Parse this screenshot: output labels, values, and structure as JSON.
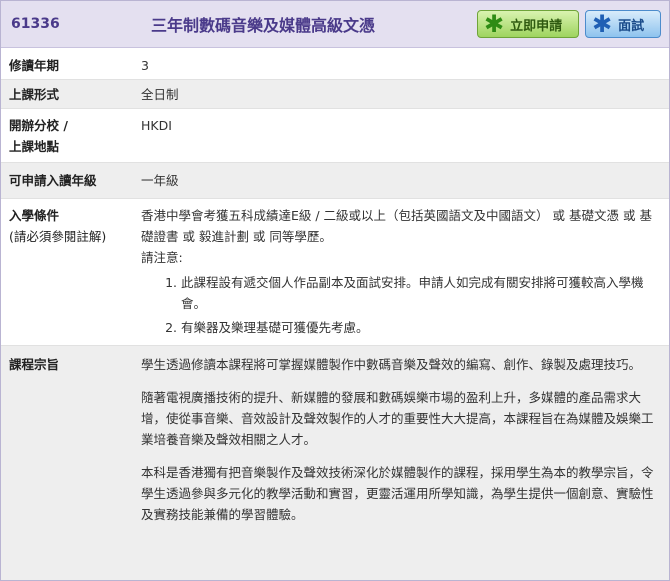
{
  "course": {
    "code": "61336",
    "title": "三年制數碼音樂及媒體高級文憑"
  },
  "buttons": {
    "apply_label": "立即申請",
    "interview_label": "面試"
  },
  "rows": {
    "duration": {
      "label": "修讀年期",
      "value": "3"
    },
    "mode": {
      "label": "上課形式",
      "value": "全日制"
    },
    "campus": {
      "label_line1": "開辦分校 /",
      "label_line2": "上課地點",
      "value": "HKDI"
    },
    "entry_year": {
      "label": "可申請入讀年級",
      "value": "一年級"
    },
    "entry_requirements": {
      "label": "入學條件",
      "sublabel": "(請必須參閱註解)",
      "text": "香港中學會考獲五科成績達E級 / 二級或以上（包括英國語文及中國語文） 或 基礎文憑 或 基礎證書 或 毅進計劃 或 同等學歷。",
      "note_heading": "請注意:",
      "notes": [
        "此課程設有遞交個人作品副本及面試安排。申請人如完成有關安排將可獲較高入學機會。",
        "有樂器及樂理基礎可獲優先考慮。"
      ]
    },
    "objectives": {
      "label": "課程宗旨",
      "paragraphs": [
        "學生透過修讀本課程將可掌握媒體製作中數碼音樂及聲效的編寫、創作、錄製及處理技巧。",
        "隨著電視廣播技術的提升、新媒體的發展和數碼娛樂市場的盈利上升，多媒體的產品需求大增，使從事音樂、音效設計及聲效製作的人才的重要性大大提高，本課程旨在為媒體及娛樂工業培養音樂及聲效相關之人才。",
        "本科是香港獨有把音樂製作及聲效技術深化於媒體製作的課程，採用學生為本的教學宗旨，令學生透過參與多元化的教學活動和實習，更靈活運用所學知識，為學生提供一個創意、實驗性及實務技能兼備的學習體驗。"
      ]
    }
  },
  "colors": {
    "header_bg": "#e4e0f0",
    "title_color": "#4a3a8a",
    "apply_green": "#9ed45f",
    "interview_blue": "#8ec3ee"
  }
}
